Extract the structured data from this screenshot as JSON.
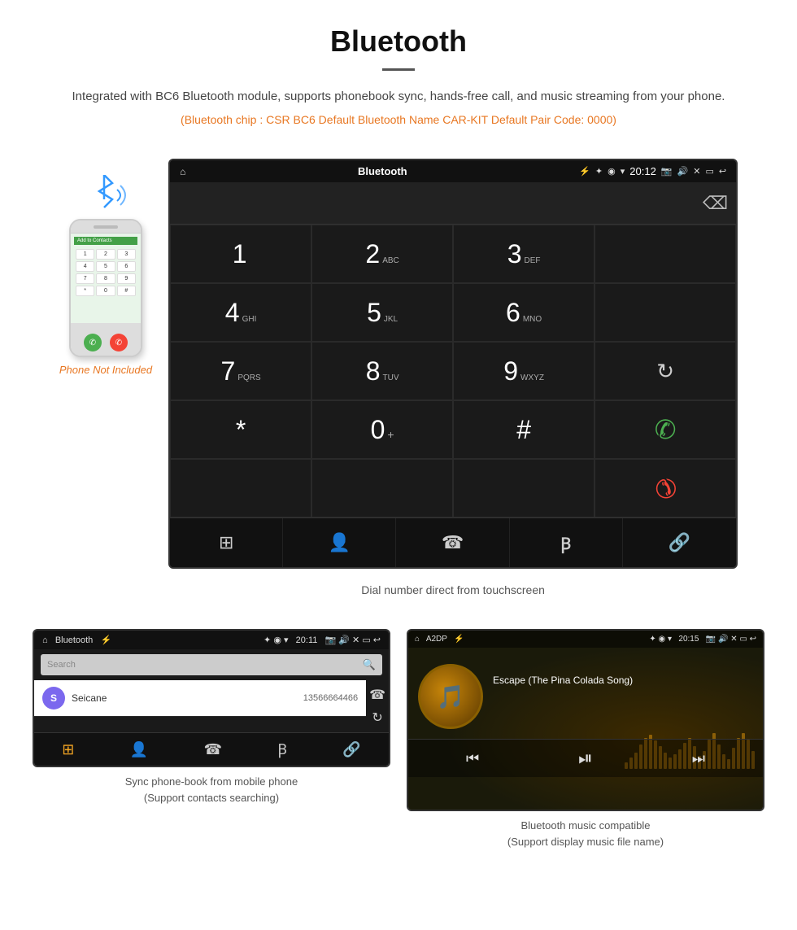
{
  "header": {
    "title": "Bluetooth",
    "description": "Integrated with BC6 Bluetooth module, supports phonebook sync, hands-free call, and music streaming from your phone.",
    "specs": "(Bluetooth chip : CSR BC6    Default Bluetooth Name CAR-KIT    Default Pair Code: 0000)"
  },
  "dialScreen": {
    "statusBar": {
      "leftIcon": "home",
      "centerLabel": "Bluetooth",
      "usbIcon": "usb",
      "time": "20:12",
      "rightIcons": [
        "bluetooth",
        "location",
        "wifi",
        "camera",
        "volume",
        "close",
        "window",
        "back"
      ]
    },
    "keys": [
      {
        "main": "1",
        "sub": ""
      },
      {
        "main": "2",
        "sub": "ABC"
      },
      {
        "main": "3",
        "sub": "DEF"
      },
      {
        "main": "",
        "sub": "",
        "type": "empty"
      },
      {
        "main": "4",
        "sub": "GHI"
      },
      {
        "main": "5",
        "sub": "JKL"
      },
      {
        "main": "6",
        "sub": "MNO"
      },
      {
        "main": "",
        "sub": "",
        "type": "empty"
      },
      {
        "main": "7",
        "sub": "PQRS"
      },
      {
        "main": "8",
        "sub": "TUV"
      },
      {
        "main": "9",
        "sub": "WXYZ"
      },
      {
        "main": "",
        "sub": "",
        "type": "refresh"
      },
      {
        "main": "*",
        "sub": ""
      },
      {
        "main": "0",
        "sub": "+"
      },
      {
        "main": "#",
        "sub": ""
      },
      {
        "main": "",
        "sub": "",
        "type": "call-green"
      },
      {
        "main": "",
        "sub": "",
        "type": "empty"
      },
      {
        "main": "",
        "sub": "",
        "type": "empty"
      },
      {
        "main": "",
        "sub": "",
        "type": "empty"
      },
      {
        "main": "",
        "sub": "",
        "type": "call-red"
      }
    ],
    "actionBar": [
      "grid",
      "user",
      "phone",
      "bluetooth",
      "link"
    ],
    "caption": "Dial number direct from touchscreen"
  },
  "phonebook": {
    "statusBar": {
      "left": "⌂  Bluetooth  ⚡",
      "right": "✦ ◉ ▾  20:11  📷  🔊  ✕  ▭  ↩"
    },
    "searchPlaceholder": "Search",
    "contacts": [
      {
        "initial": "S",
        "name": "Seicane",
        "number": "13566664466"
      }
    ],
    "caption": "Sync phone-book from mobile phone\n(Support contacts searching)"
  },
  "music": {
    "statusBar": {
      "left": "⌂  A2DP  ⚡",
      "right": "✦ ◉ ▾  20:15  📷  🔊  ✕  ▭  ↩"
    },
    "songTitle": "Escape (The Pina Colada Song)",
    "controls": [
      "prev",
      "play",
      "next"
    ],
    "caption": "Bluetooth music compatible\n(Support display music file name)"
  },
  "phone": {
    "notIncluded": "Phone Not Included"
  },
  "waveform": [
    8,
    14,
    20,
    30,
    38,
    42,
    35,
    28,
    20,
    14,
    18,
    24,
    32,
    38,
    28,
    16,
    22,
    36,
    44,
    30,
    18,
    12,
    26,
    38,
    44,
    36,
    22
  ]
}
